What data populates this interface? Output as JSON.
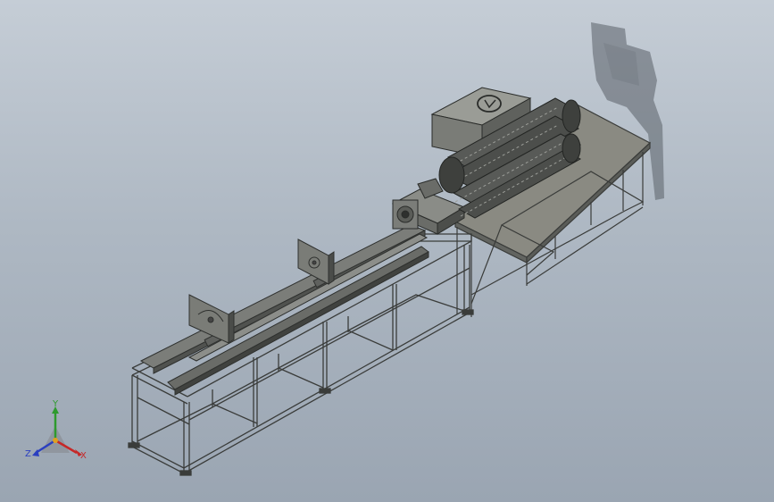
{
  "viewport": {
    "background_top": "#c5cdd6",
    "background_bottom": "#9aa5b2"
  },
  "model": {
    "frame_color": "#6e716e",
    "frame_dark": "#3a3c3a",
    "tabletop_color": "#8a8a82",
    "rail_color": "#7b7d79",
    "chain_color": "#585a57",
    "shadow_color": "#5a6068"
  },
  "triad": {
    "x_label": "X",
    "y_label": "Y",
    "z_label": "Z",
    "x_color": "#c62828",
    "y_color": "#2e9a2e",
    "z_color": "#2a3fc0"
  }
}
